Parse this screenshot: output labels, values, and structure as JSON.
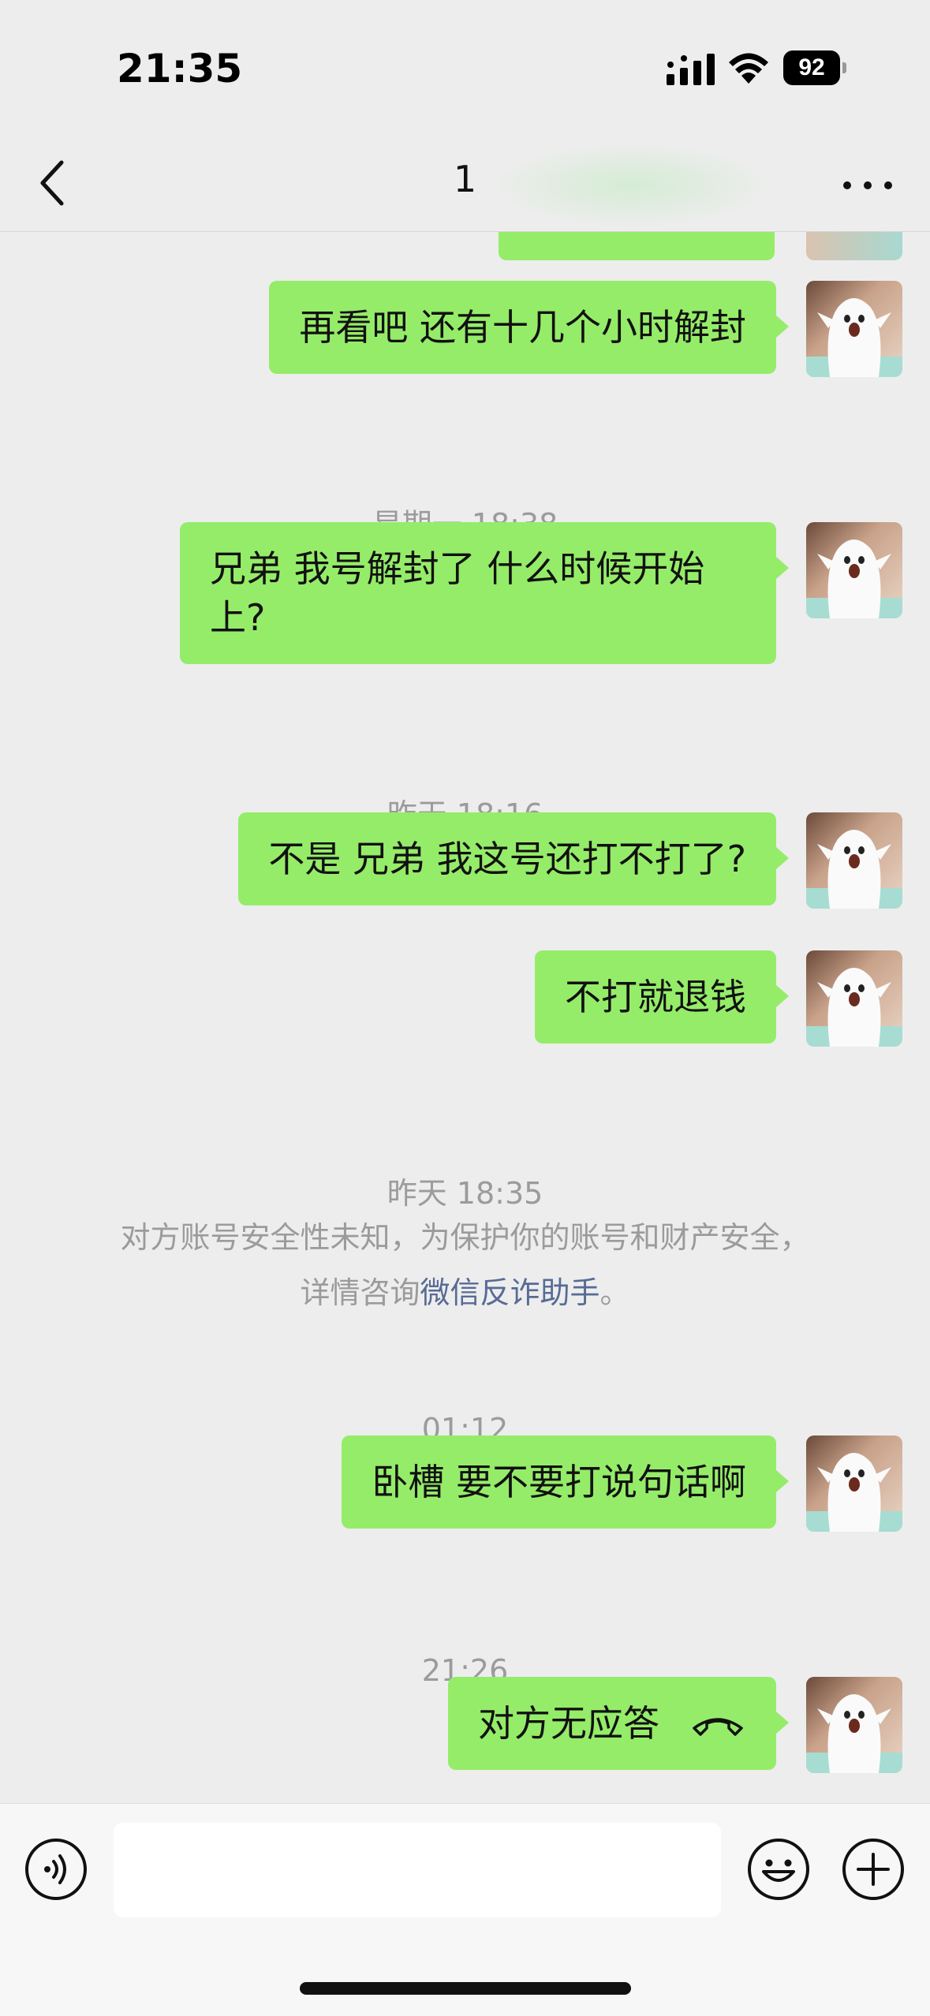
{
  "status_bar": {
    "time": "21:35",
    "battery": "92"
  },
  "nav": {
    "title": "1"
  },
  "messages": [
    {
      "text": "再看吧 还有十几个小时解封"
    },
    {
      "text": "兄弟 我号解封了 什么时候开始\n上?"
    },
    {
      "text": "不是 兄弟 我这号还打不打了?"
    },
    {
      "text": "不打就退钱"
    },
    {
      "text": "卧槽 要不要打说句话啊"
    },
    {
      "text": "对方无应答"
    }
  ],
  "timestamps": [
    "星期一 18:38",
    "昨天 18:16",
    "昨天 18:35",
    "01:12",
    "21:26"
  ],
  "notice": {
    "line1": "对方账号安全性未知，为保护你的账号和财产安全，",
    "line2_prefix": "详情咨询",
    "link": "微信反诈助手",
    "line2_suffix": "。"
  },
  "input": {
    "placeholder": ""
  },
  "colors": {
    "bubble": "#95ec69",
    "background": "#ededed",
    "link": "#576b95",
    "timestamp": "#9b9b9b"
  }
}
